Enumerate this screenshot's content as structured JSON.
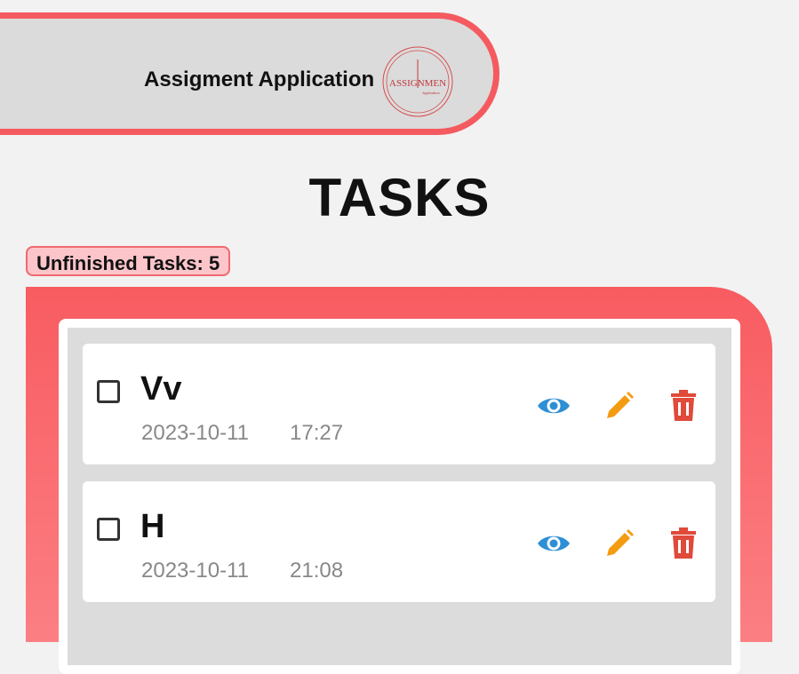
{
  "header": {
    "app_title": "Assigment Application",
    "logo_text": "ASSIGNMEN",
    "logo_subtext": "Application"
  },
  "page_title": "TASKS",
  "unfinished_badge": "Unfinished Tasks: 5",
  "tasks": [
    {
      "title": "Vv",
      "date": "2023-10-11",
      "time": "17:27",
      "done": false
    },
    {
      "title": "H",
      "date": "2023-10-11",
      "time": "21:08",
      "done": false
    }
  ],
  "icons": {
    "view": "eye-icon",
    "edit": "pencil-icon",
    "delete": "trash-icon"
  },
  "colors": {
    "accent_red": "#f45a5f",
    "view_blue": "#2d8fd5",
    "edit_orange": "#f39c12",
    "delete_red": "#e04a3a"
  }
}
